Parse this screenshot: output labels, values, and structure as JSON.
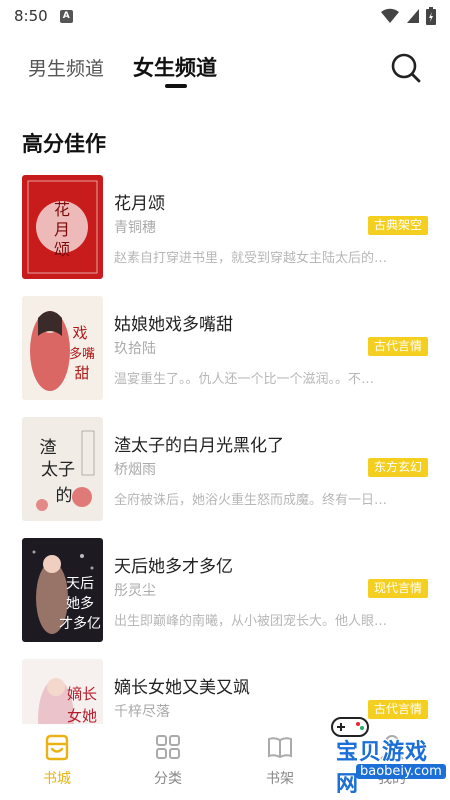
{
  "status_bar": {
    "time": "8:50",
    "a_badge": "A"
  },
  "header": {
    "tabs": [
      {
        "label": "男生频道",
        "active": false
      },
      {
        "label": "女生频道",
        "active": true
      }
    ]
  },
  "section": {
    "title": "高分佳作"
  },
  "books": [
    {
      "title": "花月颂",
      "author": "青铜穗",
      "tag": "古典架空",
      "desc": "赵素自打穿进书里，就受到穿越女主陆太后的…",
      "cover_text": "花月颂"
    },
    {
      "title": "姑娘她戏多嘴甜",
      "author": "玖拾陆",
      "tag": "古代言情",
      "desc": "温宴重生了。。仇人还一个比一个滋润。。不…",
      "cover_text": "戏多嘴甜"
    },
    {
      "title": "渣太子的白月光黑化了",
      "author": "桥烟雨",
      "tag": "东方玄幻",
      "desc": "全府被诛后，她浴火重生怒而成魔。终有一日…",
      "cover_text": "渣太子的"
    },
    {
      "title": "天后她多才多亿",
      "author": "彤灵尘",
      "tag": "现代言情",
      "desc": "出生即巅峰的南曦，从小被团宠长大。他人眼…",
      "cover_text": "天后她多才多亿"
    },
    {
      "title": "嫡长女她又美又飒",
      "author": "千梓尽落",
      "tag": "古代言情",
      "desc": "",
      "cover_text": "嫡长女她"
    }
  ],
  "bottom_nav": [
    {
      "label": "书城",
      "icon": "bookstore-icon",
      "active": true
    },
    {
      "label": "分类",
      "icon": "category-grid-icon",
      "active": false
    },
    {
      "label": "书架",
      "icon": "bookshelf-icon",
      "active": false
    },
    {
      "label": "我的",
      "icon": "profile-icon",
      "active": false
    }
  ],
  "watermark": {
    "text": "宝贝游戏网",
    "url": "baobeiy.com"
  },
  "colors": {
    "accent": "#f5cf1f",
    "nav_active": "#e9b315",
    "tag_text": "#ffffff"
  }
}
